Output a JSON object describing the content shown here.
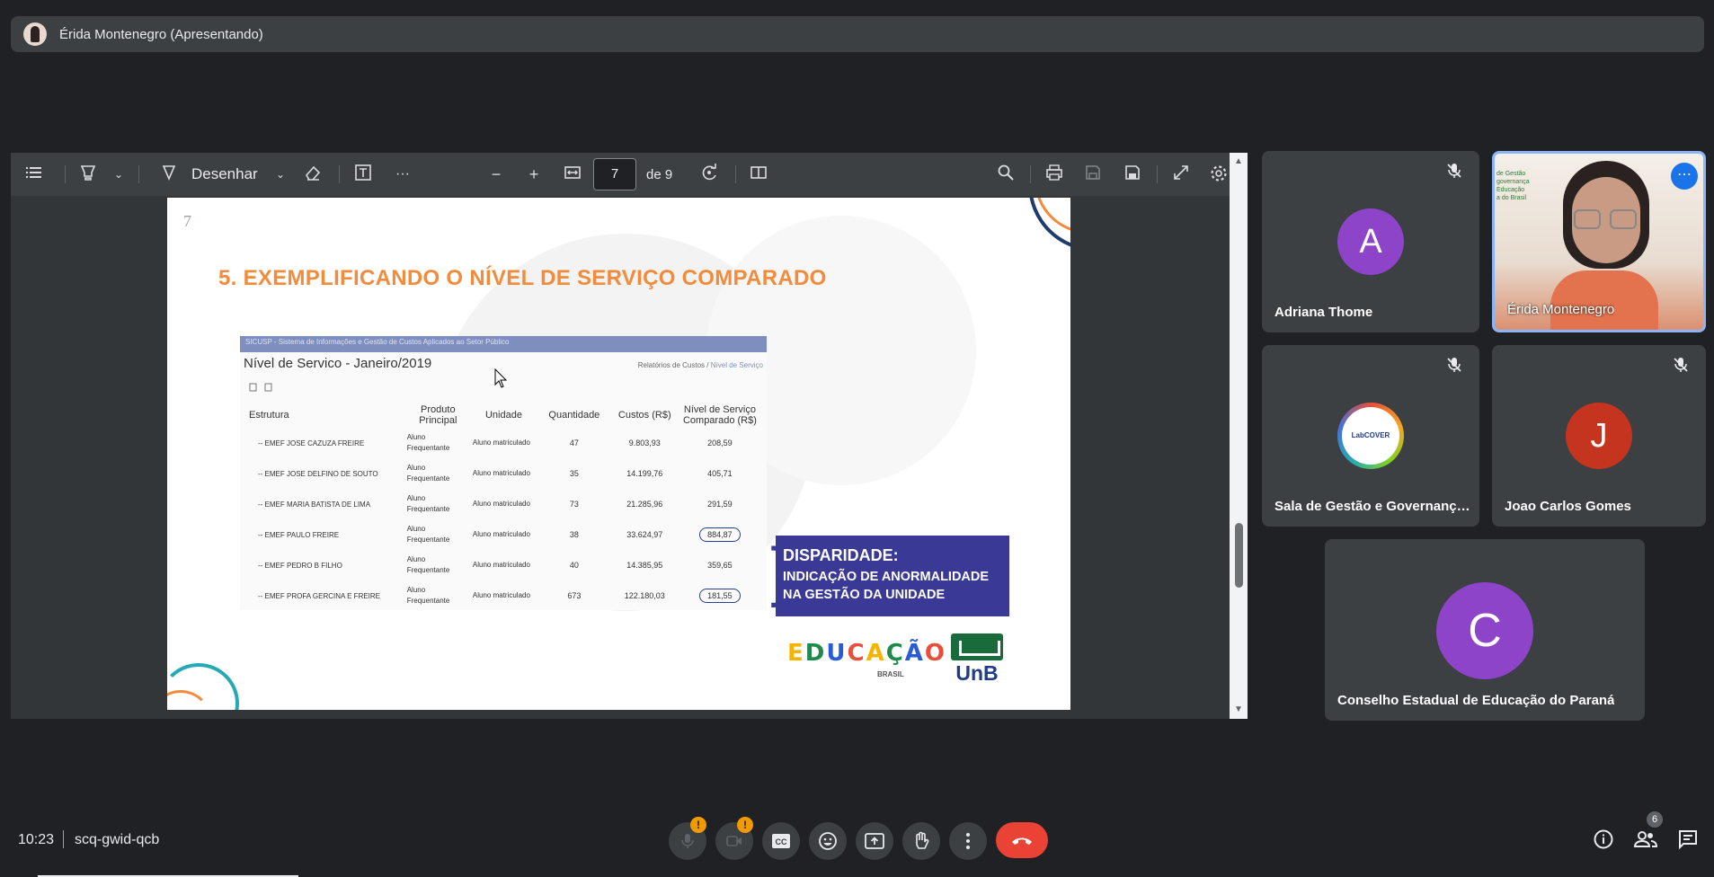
{
  "presenter": {
    "name": "Érida Montenegro (Apresentando)"
  },
  "toolbar": {
    "draw_label": "Desenhar",
    "page_current": "7",
    "page_total": "de 9"
  },
  "slide": {
    "number": "7",
    "title": "5. EXEMPLIFICANDO O NÍVEL DE SERVIÇO COMPARADO",
    "screenshot": {
      "header": "SICUSP - Sistema de Informações e Gestão de Custos Aplicados ao Setor Público",
      "title": "Nível de Servico - Janeiro/2019",
      "crumb_a": "Relatórios de Custos",
      "crumb_sep": "/",
      "crumb_b": "Nível de Serviço",
      "columns": [
        "Estrutura",
        "Produto Principal",
        "Unidade",
        "Quantidade",
        "Custos (R$)",
        "Nível de Serviço Comparado (R$)"
      ],
      "rows": [
        {
          "estrutura": "-- EMEF JOSE CAZUZA FREIRE",
          "produto": "Aluno Frequentante",
          "unidade": "Aluno matriculado",
          "quantidade": "47",
          "custos": "9.803,93",
          "nivel": "208,59"
        },
        {
          "estrutura": "-- EMEF JOSE DELFINO DE SOUTO",
          "produto": "Aluno Frequentante",
          "unidade": "Aluno matriculado",
          "quantidade": "35",
          "custos": "14.199,76",
          "nivel": "405,71"
        },
        {
          "estrutura": "-- EMEF MARIA BATISTA DE LIMA",
          "produto": "Aluno Frequentante",
          "unidade": "Aluno matriculado",
          "quantidade": "73",
          "custos": "21.285,96",
          "nivel": "291,59"
        },
        {
          "estrutura": "-- EMEF PAULO FREIRE",
          "produto": "Aluno Frequentante",
          "unidade": "Aluno matriculado",
          "quantidade": "38",
          "custos": "33.624,97",
          "nivel": "884,87"
        },
        {
          "estrutura": "-- EMEF PEDRO B FILHO",
          "produto": "Aluno Frequentante",
          "unidade": "Aluno matriculado",
          "quantidade": "40",
          "custos": "14.385,95",
          "nivel": "359,65"
        },
        {
          "estrutura": "-- EMEF PROFA GERCINA E FREIRE",
          "produto": "Aluno Frequentante",
          "unidade": "Aluno matriculado",
          "quantidade": "673",
          "custos": "122.180,03",
          "nivel": "181,55"
        }
      ]
    },
    "callout_head": "DISPARIDADE:",
    "callout_line1": "INDICAÇÃO DE ANORMALIDADE",
    "callout_line2": "NA GESTÃO DA UNIDADE",
    "logo_educacao": [
      "E",
      "D",
      "U",
      "C",
      "A",
      "Ç",
      "Ã",
      "O"
    ],
    "logo_brasil": "BRASIL",
    "logo_unb": "UnB"
  },
  "participants": [
    {
      "name": "Adriana Thome",
      "initial": "A",
      "color": "#8e44c9"
    },
    {
      "name": "Érida Montenegro"
    },
    {
      "name": "Sala de Gestão e Governança do Brasil",
      "logo_text": "LabCOVER"
    },
    {
      "name": "Joao Carlos Gomes",
      "initial": "J",
      "color": "#c5341e"
    },
    {
      "name": "Conselho Estadual de Educação do Paraná",
      "initial": "C",
      "color": "#8e44c9"
    }
  ],
  "camera_bg_text": "de Gestão\ngovernança\nEducação\na do Brasil",
  "bottom": {
    "time": "10:23",
    "meeting_code": "scq-gwid-qcb",
    "people_count": "6",
    "badge": "!"
  },
  "icons": {
    "toolbar": [
      "outline-icon",
      "highlighter-icon",
      "pen-icon",
      "eraser-icon",
      "text-box-icon",
      "more-icon",
      "zoom-out-icon",
      "zoom-in-icon",
      "fit-width-icon",
      "rotate-icon",
      "two-page-icon",
      "search-icon",
      "print-icon",
      "save-icon",
      "save-as-icon",
      "fullscreen-icon",
      "settings-icon"
    ],
    "controls": [
      "mic-off-icon",
      "camera-off-icon",
      "captions-icon",
      "emoji-icon",
      "present-icon",
      "raise-hand-icon",
      "more-options-icon",
      "hangup-icon"
    ],
    "right": [
      "info-icon",
      "people-icon",
      "chat-icon"
    ]
  },
  "colors": {
    "accent_orange": "#f28c3c",
    "callout_blue": "#3a3a96",
    "hangup_red": "#ea4335",
    "badge_amber": "#f29900"
  }
}
